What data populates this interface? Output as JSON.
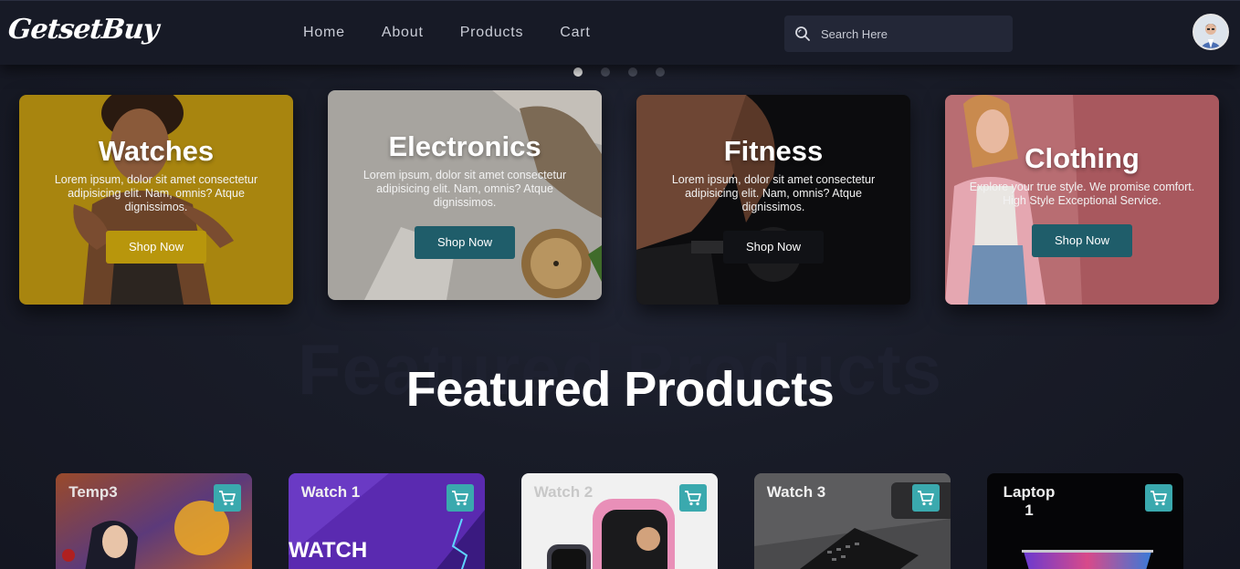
{
  "brand": {
    "logo_text": "GetsetBuy"
  },
  "nav": {
    "links": [
      {
        "label": "Home"
      },
      {
        "label": "About"
      },
      {
        "label": "Products"
      },
      {
        "label": "Cart"
      }
    ]
  },
  "search": {
    "placeholder": "Search Here",
    "value": "",
    "icon": "search-icon"
  },
  "carousel": {
    "slide_count": 4,
    "active_index": 0
  },
  "banners": [
    {
      "title": "Watches",
      "text": "Lorem ipsum, dolor sit amet consectetur adipisicing elit. Nam, omnis? Atque dignissimos.",
      "button": "Shop Now",
      "button_color": "#b8960c"
    },
    {
      "title": "Electronics",
      "text": "Lorem ipsum, dolor sit amet consectetur adipisicing elit. Nam, omnis? Atque dignissimos.",
      "button": "Shop Now",
      "button_color": "#1f5d6a"
    },
    {
      "title": "Fitness",
      "text": "Lorem ipsum, dolor sit amet consectetur adipisicing elit. Nam, omnis? Atque dignissimos.",
      "button": "Shop Now",
      "button_color": "#111216"
    },
    {
      "title": "Clothing",
      "text": "Explore your true style. We promise comfort. High Style Exceptional Service.",
      "button": "Shop Now",
      "button_color": "#1f5d6a"
    }
  ],
  "featured": {
    "background_text": "Featured Products",
    "title": "Featured Products",
    "products": [
      {
        "label": "Temp3",
        "cart_icon": "cart-icon"
      },
      {
        "label": "Watch 1",
        "cart_icon": "cart-icon"
      },
      {
        "label": "Watch 2",
        "cart_icon": "cart-icon"
      },
      {
        "label": "Watch 3",
        "cart_icon": "cart-icon"
      },
      {
        "label": "Laptop 1",
        "cart_icon": "cart-icon"
      }
    ]
  },
  "colors": {
    "accent": "#3aa9ae",
    "background": "#171a26"
  }
}
